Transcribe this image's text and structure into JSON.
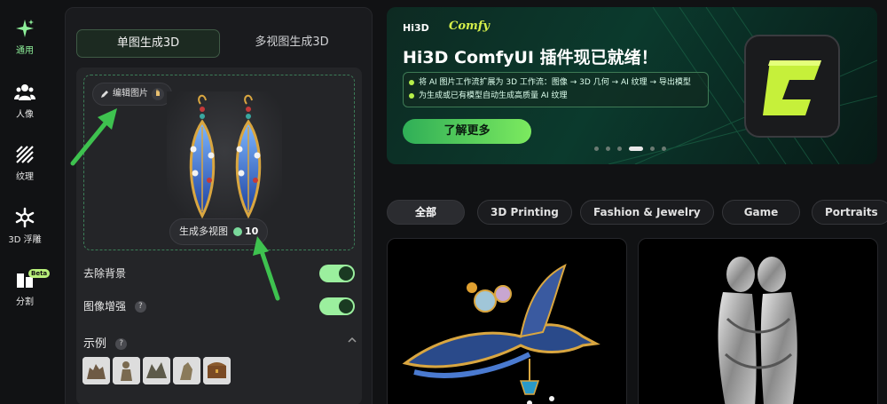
{
  "nav": {
    "items": [
      {
        "label": "通用",
        "icon": "sparkle-icon",
        "active": true
      },
      {
        "label": "人像",
        "icon": "people-icon"
      },
      {
        "label": "纹理",
        "icon": "texture-icon"
      },
      {
        "label": "3D 浮雕",
        "icon": "relief-icon"
      },
      {
        "label": "分割",
        "icon": "segment-icon",
        "badge": "Beta"
      }
    ]
  },
  "panel": {
    "tabs": [
      "单图生成3D",
      "多视图生成3D"
    ],
    "edit_image_label": "编辑图片",
    "generate_multiview_label": "生成多视图",
    "credits": "10",
    "remove_bg_label": "去除背景",
    "enhance_label": "图像增强",
    "help_symbol": "?",
    "examples_title": "示例",
    "remove_bg_on": true,
    "enhance_on": true
  },
  "banner": {
    "brand": "Hi3D",
    "brand2": "Comfy",
    "title": "Hi3D ComfyUI 插件现已就绪！",
    "point1": "将 AI 图片工作流扩展为 3D 工作流：图像 → 3D 几何 → AI 纹理 → 导出模型",
    "point2": "为生成或已有模型自动生成高质量 AI 纹理",
    "cta": "了解更多",
    "dot_count": 6,
    "active_dot": 3
  },
  "filters": [
    "全部",
    "3D Printing",
    "Fashion & Jewelry",
    "Game",
    "Portraits"
  ],
  "colors": {
    "accent": "#9bef9e",
    "banner_bg": "#0b3a2d",
    "cta": "#7cea5f"
  }
}
